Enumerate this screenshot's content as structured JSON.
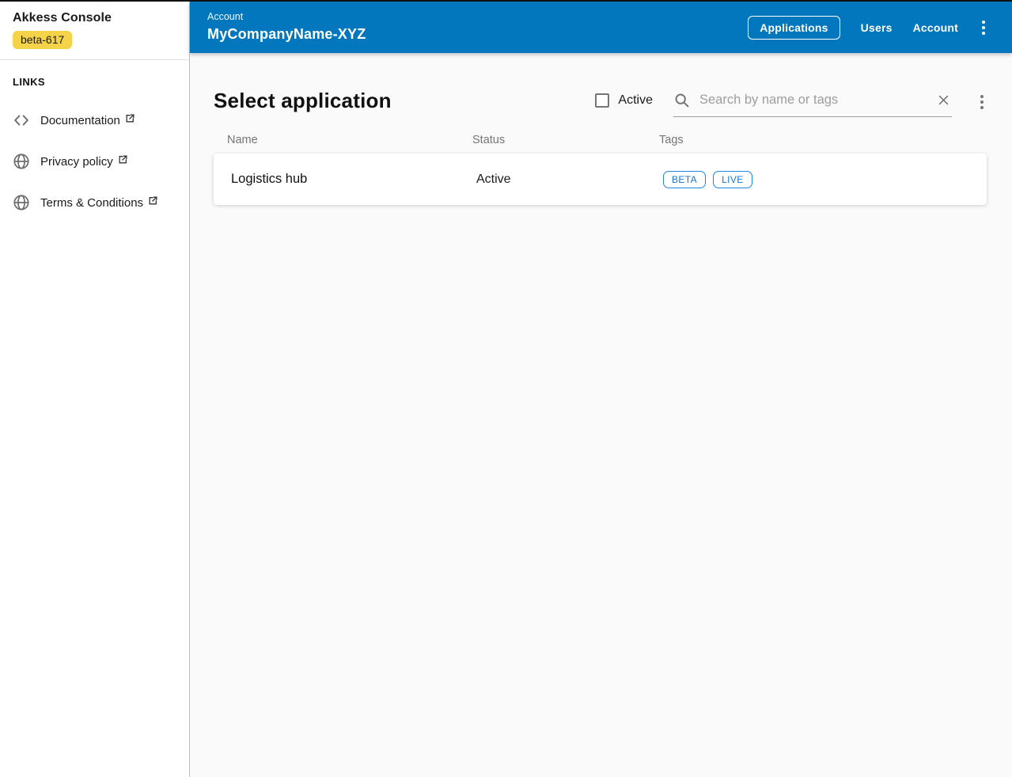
{
  "colors": {
    "header_bg": "#0277bd",
    "badge_bg": "#f5d349",
    "chip_color": "#1e88e5",
    "main_bg": "#fafafa",
    "muted_text": "#757575"
  },
  "sidebar": {
    "title": "Akkess Console",
    "badge": "beta-617",
    "links_header": "LINKS",
    "links": [
      {
        "label": "Documentation",
        "icon": "code-icon",
        "external": true
      },
      {
        "label": "Privacy policy",
        "icon": "globe-icon",
        "external": true
      },
      {
        "label": "Terms & Conditions",
        "icon": "globe-icon",
        "external": true
      }
    ]
  },
  "header": {
    "overline": "Account",
    "title": "MyCompanyName-XYZ",
    "nav": [
      {
        "label": "Applications",
        "selected": true
      },
      {
        "label": "Users",
        "selected": false
      },
      {
        "label": "Account",
        "selected": false
      }
    ],
    "menu_icon": "kebab-menu-icon"
  },
  "main": {
    "heading": "Select application",
    "active_filter": {
      "label": "Active",
      "checked": false
    },
    "search": {
      "placeholder": "Search by name or tags",
      "value": "",
      "left_icon": "search-icon",
      "right_icon": "clear-icon"
    },
    "menu_icon": "kebab-menu-icon",
    "table": {
      "columns": [
        "Name",
        "Status",
        "Tags"
      ],
      "rows": [
        {
          "name": "Logistics hub",
          "status": "Active",
          "tags": [
            "BETA",
            "LIVE"
          ]
        }
      ]
    }
  }
}
